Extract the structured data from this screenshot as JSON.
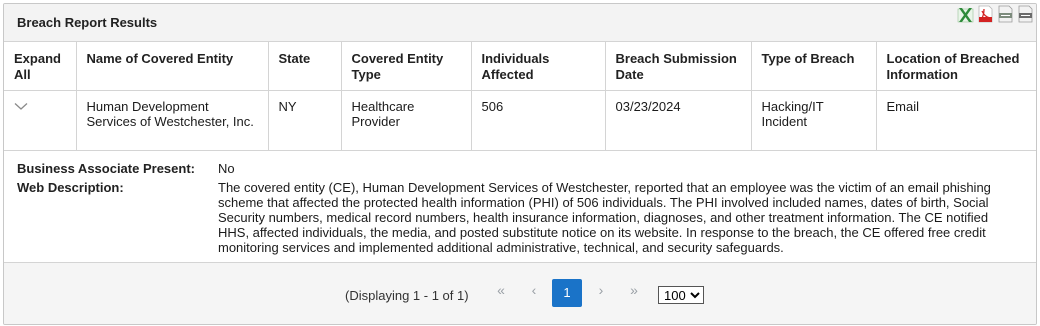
{
  "panel": {
    "title": "Breach Report Results",
    "export_icons": [
      "excel-export-icon",
      "pdf-export-icon",
      "csv-export-icon",
      "xml-export-icon"
    ]
  },
  "table": {
    "headers": {
      "expand": "Expand All",
      "name": "Name of Covered Entity",
      "state": "State",
      "type": "Covered Entity Type",
      "affected": "Individuals Affected",
      "date": "Breach Submission Date",
      "breach_type": "Type of Breach",
      "location": "Location of Breached Information"
    },
    "rows": [
      {
        "toggle_icon": "chevron-down-icon",
        "name": "Human Development Services of Westchester, Inc.",
        "state": "NY",
        "type": "Healthcare Provider",
        "affected": "506",
        "date": "03/23/2024",
        "breach_type": "Hacking/IT Incident",
        "location": "Email"
      }
    ]
  },
  "details": {
    "ba_label": "Business Associate Present:",
    "ba_value": "No",
    "desc_label": "Web Description:",
    "desc_value": "The covered entity (CE), Human Development Services of Westchester, reported that an employee was the victim of an email phishing scheme that affected the protected health information (PHI) of 506 individuals. The PHI involved included names, dates of birth, Social Security numbers, medical record numbers, health insurance information, diagnoses, and other treatment information. The CE notified HHS, affected individuals, the media, and posted substitute notice on its website. In response to the breach, the CE offered free credit monitoring services and implemented additional administrative, technical, and security safeguards."
  },
  "pager": {
    "info": "(Displaying 1 - 1 of 1)",
    "first": "«",
    "prev": "‹",
    "current": "1",
    "next": "›",
    "last": "»",
    "page_size": "100",
    "page_size_options": [
      "100"
    ]
  },
  "colors": {
    "accent": "#1a73c8",
    "header_bg": "#f3f3f3",
    "border": "#d4d4d4"
  }
}
